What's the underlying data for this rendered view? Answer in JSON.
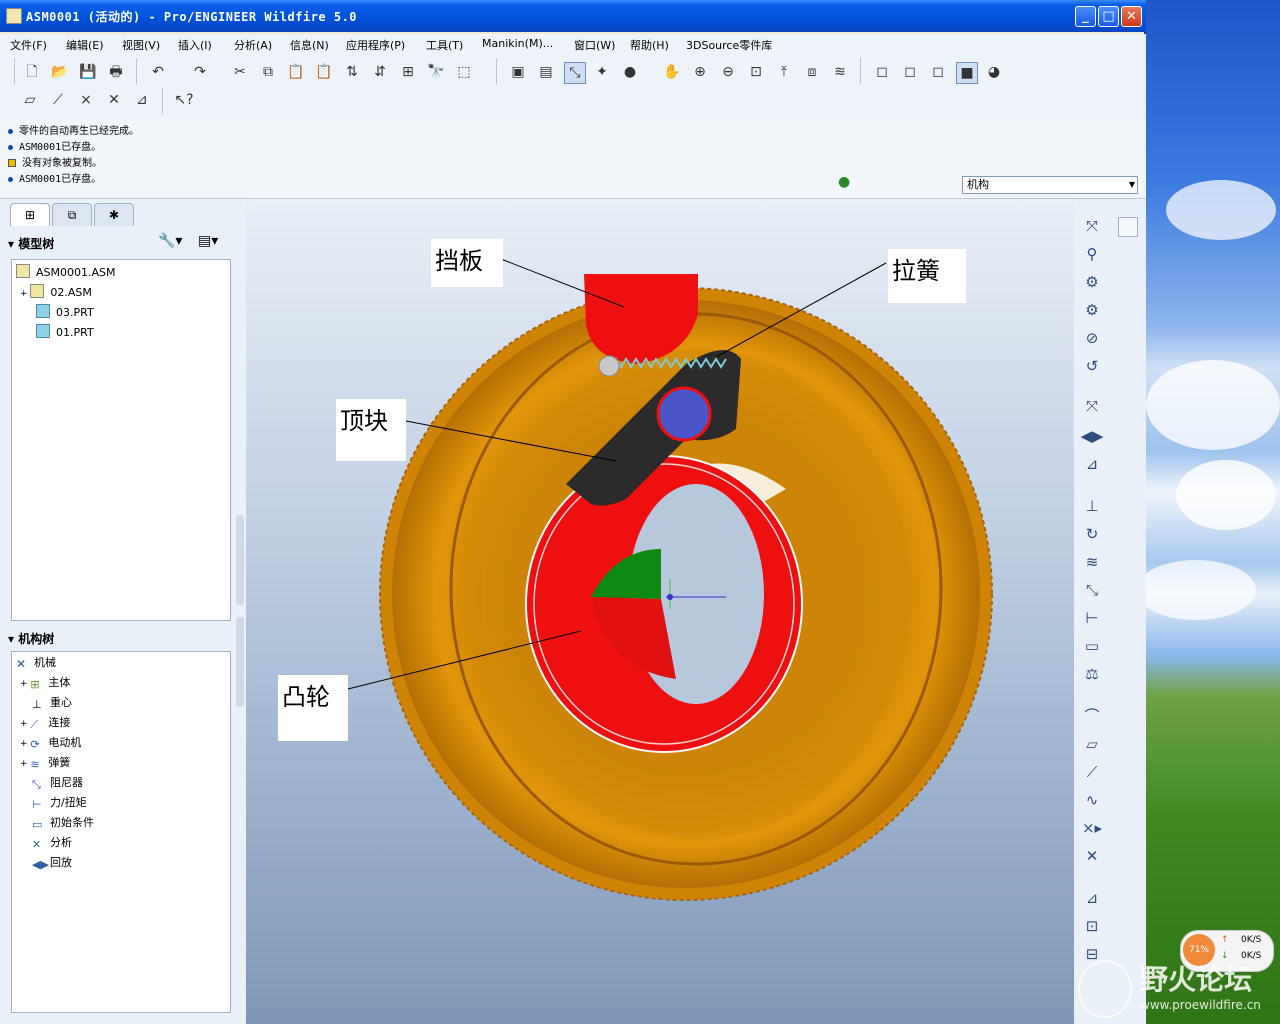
{
  "window": {
    "title": "ASM0001 (活动的) - Pro/ENGINEER Wildfire 5.0",
    "controls": {
      "minimize": "_",
      "maximize": "□",
      "close": "✕"
    }
  },
  "menu": [
    "文件(F)",
    "编辑(E)",
    "视图(V)",
    "插入(I)",
    "分析(A)",
    "信息(N)",
    "应用程序(P)",
    "工具(T)",
    "Manikin(M)...",
    "窗口(W)",
    "帮助(H)",
    "3DSource零件库"
  ],
  "messages": [
    "零件的自动再生已经完成。",
    "ASM0001已存盘。",
    "没有对象被复制。",
    "ASM0001已存盘。"
  ],
  "selector": {
    "value": "机构"
  },
  "left_panel": {
    "tabs": [
      "model-tree-tab",
      "layers-tab",
      "favorites-tab"
    ],
    "model_tree": {
      "header": "模型树",
      "items": [
        "ASM0001.ASM",
        "02.ASM",
        "03.PRT",
        "01.PRT"
      ]
    },
    "mechanism_tree": {
      "header": "机构树",
      "items": [
        "机械",
        "主体",
        "重心",
        "连接",
        "电动机",
        "弹簧",
        "阻尼器",
        "力/扭矩",
        "初始条件",
        "分析",
        "回放"
      ]
    }
  },
  "annotations": {
    "baffle": "挡板",
    "spring": "拉簧",
    "top_block": "顶块",
    "cam": "凸轮"
  },
  "network_monitor": {
    "cpu": "71%",
    "upload": "0K/S",
    "download": "0K/S"
  },
  "watermark": {
    "name": "野火论坛",
    "url": "www.proewildfire.cn"
  },
  "colors": {
    "gear": "#d98a05",
    "cam": "#ee1010",
    "baffle": "#ee1010",
    "arm": "#2b2b2b",
    "pin": "#4a56c8",
    "green_face": "#0e8a12",
    "titlebar": "#0a5fe8"
  }
}
